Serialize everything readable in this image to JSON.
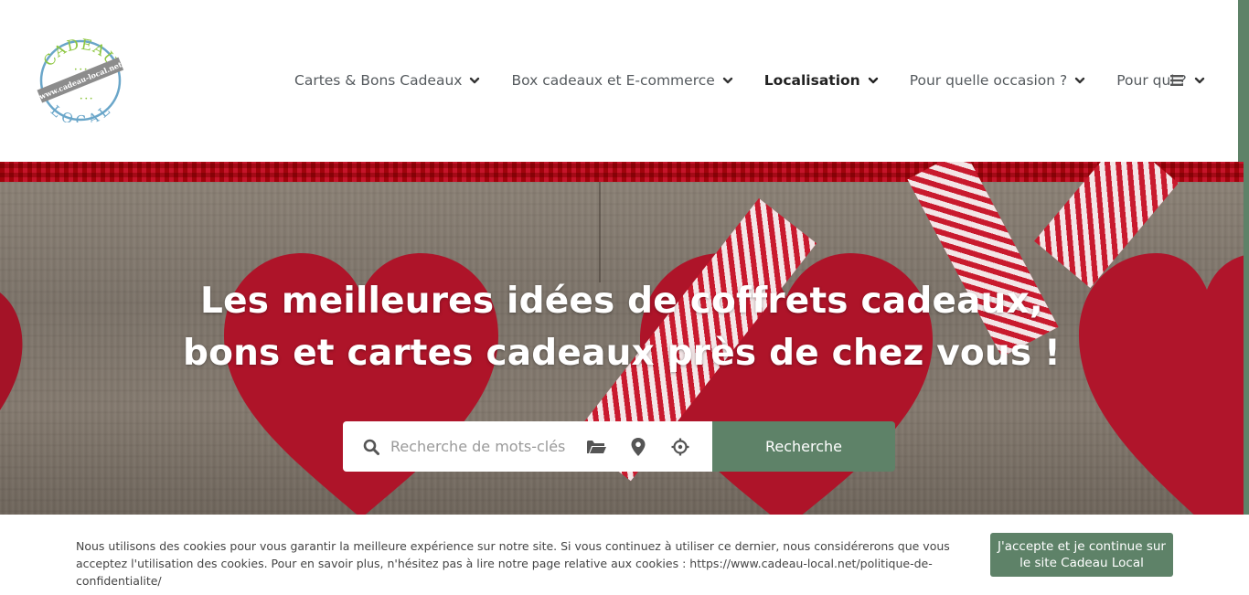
{
  "brand": {
    "logo_top_text": "CADEAU",
    "logo_band_text": "www.cadeau-local.net",
    "logo_bottom_text": "LOCAL",
    "accent_color": "#5e8268",
    "logo_green": "#8dc63f",
    "logo_blue": "#6aa6c9"
  },
  "nav": {
    "items": [
      {
        "label": "Cartes & Bons Cadeaux",
        "icon": "chevron-down-icon",
        "active": false
      },
      {
        "label": "Box cadeaux et E-commerce",
        "icon": "chevron-down-icon",
        "active": false
      },
      {
        "label": "Localisation",
        "icon": "chevron-down-icon",
        "active": true
      },
      {
        "label": "Pour quelle occasion ?",
        "icon": "chevron-down-icon",
        "active": false
      },
      {
        "label": "Pour qui ?",
        "icon": "chevron-down-icon",
        "active": false
      }
    ],
    "menu_icon": "hamburger-menu-icon"
  },
  "hero": {
    "title_line1": "Les meilleures idées de coffrets cadeaux,",
    "title_line2": "bons et cartes cadeaux près de chez vous !"
  },
  "search": {
    "placeholder": "Recherche de mots-clés",
    "value": "",
    "icons": [
      "search-icon",
      "folder-open-icon",
      "map-pin-icon",
      "crosshair-location-icon"
    ],
    "button_label": "Recherche"
  },
  "cookie": {
    "text": "Nous utilisons des cookies pour vous garantir la meilleure expérience sur notre site. Si vous continuez à utiliser ce dernier, nous considérerons que vous acceptez l'utilisation des cookies. Pour en savoir plus, n'hésitez pas à lire notre page relative aux cookies : https://www.cadeau-local.net/politique-de-confidentialite/",
    "button_label": "J'accepte et je continue sur le site Cadeau Local"
  }
}
